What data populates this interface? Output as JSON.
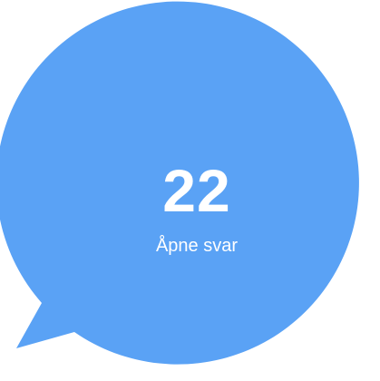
{
  "widget": {
    "count": "22",
    "label": "Åpne svar",
    "bubble_color": "#5aa2f5",
    "text_color": "#ffffff",
    "icon": "speech-bubble-icon"
  }
}
